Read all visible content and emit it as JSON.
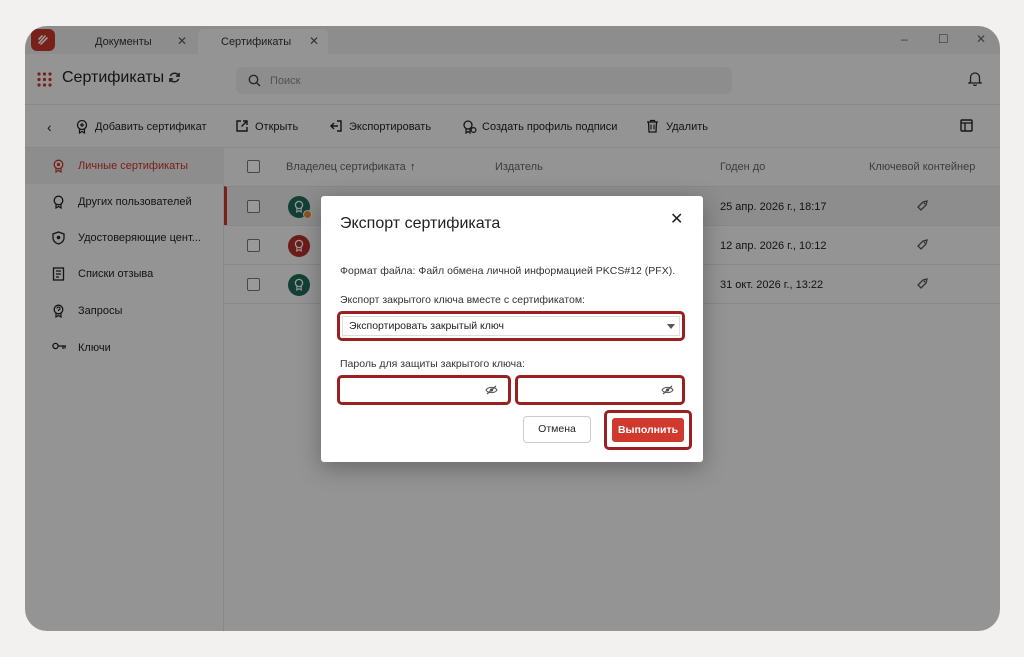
{
  "titlebar": {
    "tabs": [
      {
        "label": "Документы",
        "close": "✕"
      },
      {
        "label": "Сертификаты",
        "close": "✕"
      }
    ],
    "controls": {
      "minimize": "–",
      "maximize": "☐",
      "close": "✕"
    }
  },
  "header": {
    "title": "Сертификаты",
    "search_placeholder": "Поиск"
  },
  "toolbar": {
    "back": "‹",
    "add": "Добавить сертификат",
    "open": "Открыть",
    "export": "Экспортировать",
    "profile": "Создать профиль подписи",
    "delete": "Удалить"
  },
  "sidebar": {
    "items": [
      {
        "label": "Личные сертификаты"
      },
      {
        "label": "Других пользователей"
      },
      {
        "label": "Удостоверяющие цент..."
      },
      {
        "label": "Списки отзыва"
      },
      {
        "label": "Запросы"
      },
      {
        "label": "Ключи"
      }
    ]
  },
  "table": {
    "columns": {
      "owner": "Владелец сертификата",
      "sort_arrow": "↑",
      "issuer": "Издатель",
      "valid_to": "Годен до",
      "container": "Ключевой контейнер"
    },
    "rows": [
      {
        "valid_to": "25 апр. 2026 г., 18:17",
        "avatar_color": "#1e6b5a"
      },
      {
        "valid_to": "12 апр. 2026 г., 10:12",
        "avatar_color": "#b5302a"
      },
      {
        "valid_to": "31 окт. 2026 г., 13:22",
        "avatar_color": "#1e6b5a"
      }
    ]
  },
  "dialog": {
    "title": "Экспорт сертификата",
    "close": "✕",
    "format_text": "Формат файла: Файл обмена личной информацией PKCS#12 (PFX).",
    "private_key_label": "Экспорт закрытого ключа вместе с сертификатом:",
    "private_key_value": "Экспортировать закрытый ключ",
    "password_label": "Пароль для защиты закрытого ключа:",
    "cancel": "Отмена",
    "submit": "Выполнить"
  },
  "colors": {
    "accent": "#c9362c",
    "highlight": "#9b1f1f"
  }
}
